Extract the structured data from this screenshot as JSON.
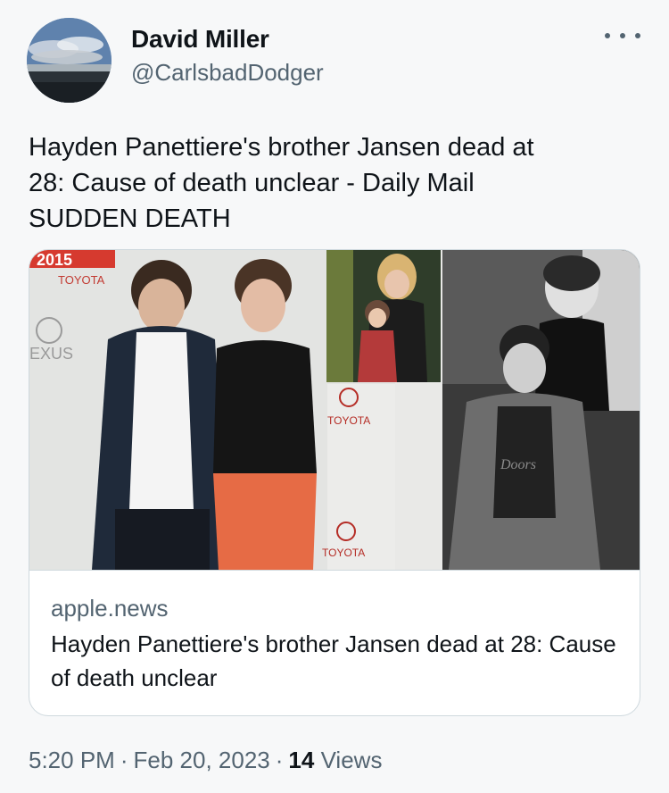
{
  "author": {
    "display_name": "David Miller",
    "handle": "@CarlsbadDodger"
  },
  "tweet": {
    "text": "Hayden Panettiere's brother Jansen dead at\n28: Cause of death unclear - Daily Mail\nSUDDEN DEATH"
  },
  "card": {
    "domain": "apple.news",
    "title": "Hayden Panettiere's brother Jansen dead at 28: Cause of death unclear",
    "image_text": {
      "banner": "2015",
      "sponsor": "TOYOTA",
      "sponsor_2": "TOYOTA",
      "sponsor_3": "TOYOTA",
      "sponsor_4": "TOYOTA",
      "brand": "EXUS",
      "shirt": "Doors"
    }
  },
  "meta": {
    "time": "5:20 PM",
    "date": "Feb 20, 2023",
    "views_count": "14",
    "views_label": "Views"
  },
  "icons": {
    "more": "more-horizontal-icon"
  }
}
